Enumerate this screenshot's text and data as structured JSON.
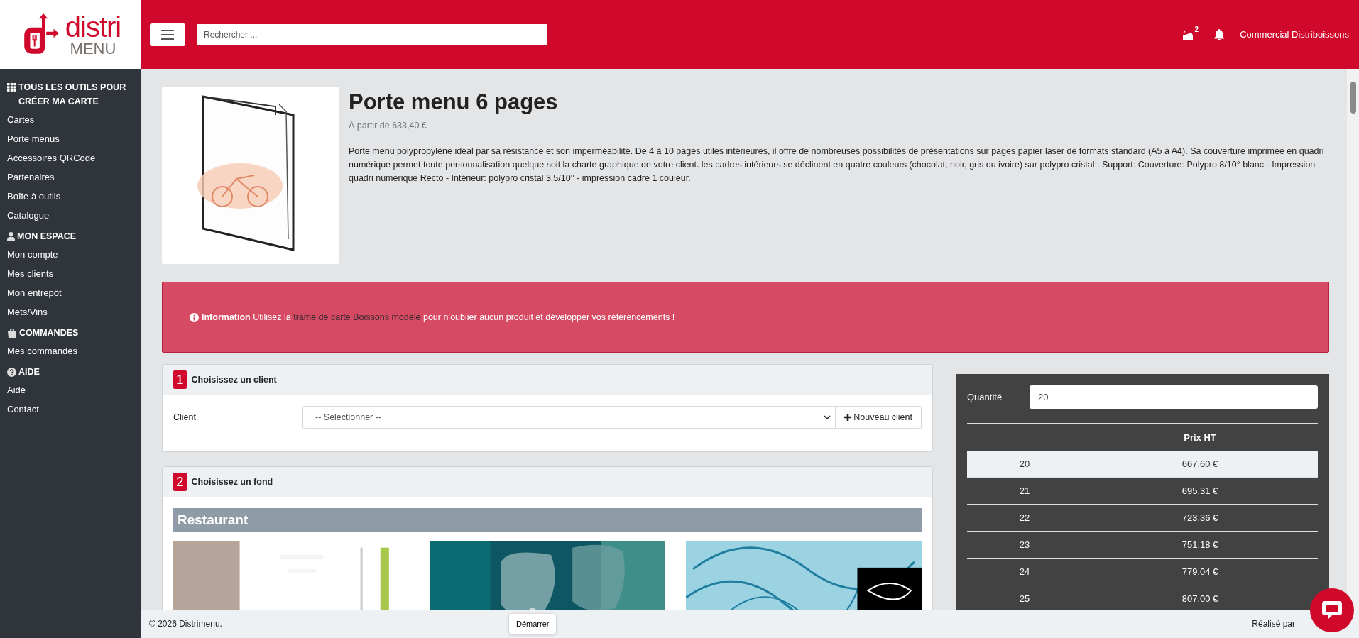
{
  "logo": {
    "word": "distri",
    "subword": "MENU"
  },
  "header": {
    "search": {
      "placeholder": "Rechercher ..."
    },
    "badge": "2",
    "user": "Commercial Distriboissons"
  },
  "sidebar": {
    "sections": [
      {
        "title": "TOUS LES OUTILS POUR CRÉER MA CARTE",
        "items": [
          "Cartes",
          "Porte menus",
          "Accessoires QRCode",
          "Partenaires",
          "Boîte à outils",
          "Catalogue"
        ]
      },
      {
        "title": "MON ESPACE",
        "items": [
          "Mon compte",
          "Mes clients",
          "Mon entrepôt",
          "Mets/Vins"
        ]
      },
      {
        "title": "COMMANDES",
        "items": [
          "Mes commandes"
        ]
      },
      {
        "title": "AIDE",
        "items": [
          "Aide",
          "Contact"
        ]
      }
    ]
  },
  "product": {
    "title": "Porte menu 6 pages",
    "price": "À partir de 633,40 €",
    "description": "Porte menu polypropylène idéal par sa résistance et son imperméabilité. De 4 à 10 pages utiles intérieures, il offre de nombreuses possibilités de présentations sur pages papier laser de formats standard (A5 à A4). Sa couverture imprimée en quadri numérique permet toute personnalisation quelque soit la charte graphique de votre client. les cadres intérieurs se déclinent en quatre couleurs (chocolat, noir, gris ou ivoire) sur polypro cristal : Support: Couverture: Polypro 8/10° blanc - Impression quadri numérique  Recto - Intérieur: polypro cristal 3,5/10° - impression cadre 1 couleur."
  },
  "info": {
    "label": "Information",
    "before": "Utilisez la",
    "link": "trame de carte Boissons modèle",
    "after": "pour n’oublier aucun produit et développer vos référencements !"
  },
  "steps": [
    {
      "number": "1",
      "title": "Choisissez un client",
      "field_label": "Client",
      "select": "-- Sélectionner --",
      "button": "Nouveau client"
    },
    {
      "number": "2",
      "title": "Choisissez un fond",
      "category": "Restaurant"
    }
  ],
  "pricing": {
    "quantity_label": "Quantité",
    "quantity": "20",
    "columns": [
      "",
      "Prix HT"
    ],
    "rows": [
      {
        "quantity": "20",
        "price": "667,60 €",
        "selected": true
      },
      {
        "quantity": "21",
        "price": "695,31 €",
        "selected": false
      },
      {
        "quantity": "22",
        "price": "723,36 €",
        "selected": false
      },
      {
        "quantity": "23",
        "price": "751,18 €",
        "selected": false
      },
      {
        "quantity": "24",
        "price": "779,04 €",
        "selected": false
      },
      {
        "quantity": "25",
        "price": "807,00 €",
        "selected": false
      }
    ]
  },
  "footer": {
    "copyright": "© 2026 Distrimenu.",
    "start_button": "Démarrer",
    "credit": "Réalisé par"
  }
}
